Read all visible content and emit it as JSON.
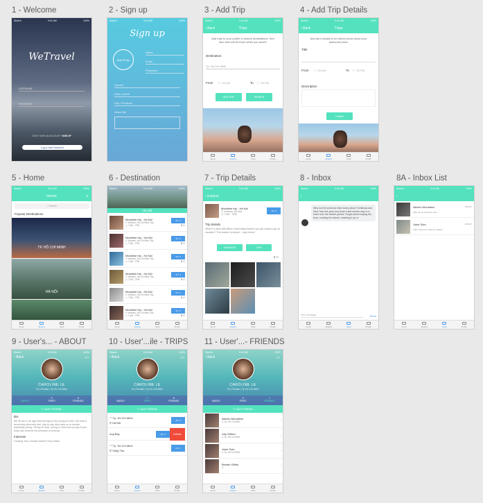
{
  "labels": [
    "1 - Welcome",
    "2 - Sign up",
    "3 - Add Trip",
    "4 - Add Trip Details",
    "5 - Home",
    "6 - Destination",
    "7 - Trip Details",
    "8 - Inbox",
    "8A - Inbox List",
    "9 - User's... - ABOUT",
    "10 - User'...ile - TRIPS",
    "11 - User'...- FRIENDS"
  ],
  "status": {
    "carrier": "Sketch",
    "time": "9:41 AM",
    "battery": "100%"
  },
  "welcome": {
    "logo": "WeTravel",
    "username": "USERNAME",
    "password": "PASSWORD",
    "no_account": "DON'T HAVE AN ACCOUNT?",
    "signup": "SIGN UP",
    "facebook": "Log in with Facebook"
  },
  "signup": {
    "title": "Sign up",
    "add_photo": "Add Photo",
    "fields": [
      "Name",
      "Email",
      "Password"
    ],
    "fields2": [
      "Gender",
      "Date of birth",
      "City / Province",
      "About Me"
    ]
  },
  "add_trip": {
    "nav": "Trips",
    "back": "Back",
    "intro": "Add trips to your profile or search destinations. See who else will be there when you arrive!",
    "destination_label": "Destination",
    "destination_value": "Tp. Hồ Chí Minh",
    "from": "From",
    "from_val": "7 : 00 AM",
    "to": "To",
    "to_val": "7 : 00 PM",
    "add_btn": "ADD TRIP",
    "search_btn": "SEARCH"
  },
  "add_details": {
    "nav": "Trips",
    "back": "Back",
    "intro": "Add trip's details to let others know about your awesome plan!",
    "title_label": "Title",
    "from": "From",
    "from_val": "7 : 00 AM",
    "to": "To",
    "to_val": "7 : 00 PM",
    "desc_label": "Description",
    "publish": "Publish"
  },
  "home": {
    "nav": "Home",
    "search": "Search",
    "section": "Popular Destinations",
    "cities": [
      "TP. HỒ CHÍ MINH",
      "HÀ NỘI"
    ]
  },
  "destination": {
    "title": "Hà Nội",
    "trip_title": "Motobike trip - Hà Nội",
    "location": "Vietnam, Ha Chi Minh City",
    "time": "7 AM - 7PM",
    "date": "16 / 4",
    "date2": "16 / 4"
  },
  "trip_details": {
    "nav": "Explore",
    "back": "Explore",
    "title": "Motobike trip - Hà Nội",
    "location": "Vietnam, Hà Nội",
    "time": "7 AM - 7PM",
    "heading": "Trip details",
    "desc": "What if a dank title Mikoe Head Island before you get ready to go on vacation? The answer is simple... stay home!",
    "message": "MESSAGE",
    "join": "JOIN",
    "count": "5"
  },
  "inbox": {
    "message": "Why not let someone else worry about Christmas and New Year this year and book a last minute stay in a hotel over the festive period. Forget about buying the food, cooking the dinner, washing it up or",
    "placeholder": "New Message",
    "send": "Send"
  },
  "inbox_list": {
    "items": [
      {
        "name": "Alberto Montalesi",
        "preview": "Why not let someone else",
        "date": "18/3/17"
      },
      {
        "name": "Josie Soto",
        "preview": "Trips Travel On Track For Better",
        "date": "15/3/17"
      }
    ]
  },
  "profile": {
    "back": "Back",
    "name": "CAROLINE LE",
    "sub": "20 | Female | Tp Ho Chi Minh",
    "tabs": [
      {
        "label": "ABOUT",
        "count": ""
      },
      {
        "label": "TRIPS",
        "count": "3"
      },
      {
        "label": "FRIENDS",
        "count": "5"
      }
    ],
    "add_friend": "ADD FRIEND",
    "bio_label": "Bio",
    "bio": "We all live in an age that belongs to the young at heart. Life that is becoming extremely fast, day to day, also asks us to remain physically young. Young at heart, young in mind and young in your body has become the principle of survival.",
    "interests_label": "Interests",
    "interests": "Cooking Your Chicken Before They Hatch"
  },
  "trips_list": [
    {
      "from": "Tp. Hồ Chí Minh",
      "to": "Hà Nội",
      "date": "16 / 4"
    },
    {
      "from": "",
      "to": "",
      "date": "16 / 4",
      "extra": "Delete"
    },
    {
      "from": "Tp. Hồ Chí Minh",
      "to": "Vũng Tàu",
      "date": "20 / 1"
    }
  ],
  "trips_mid": "ong Bay",
  "friends": [
    {
      "name": "Alberto Montalesi",
      "city": "Tp. Hồ Chí Minh"
    },
    {
      "name": "Lilly Gilbert",
      "city": "Tp. Hồ Chí Minh"
    },
    {
      "name": "Josie Soto",
      "city": "Tp. Hồ Chí Minh"
    },
    {
      "name": "Beulah Gibbs",
      "city": ""
    }
  ],
  "tabs": [
    "Home",
    "Explore",
    "Inbox",
    "Profile"
  ]
}
